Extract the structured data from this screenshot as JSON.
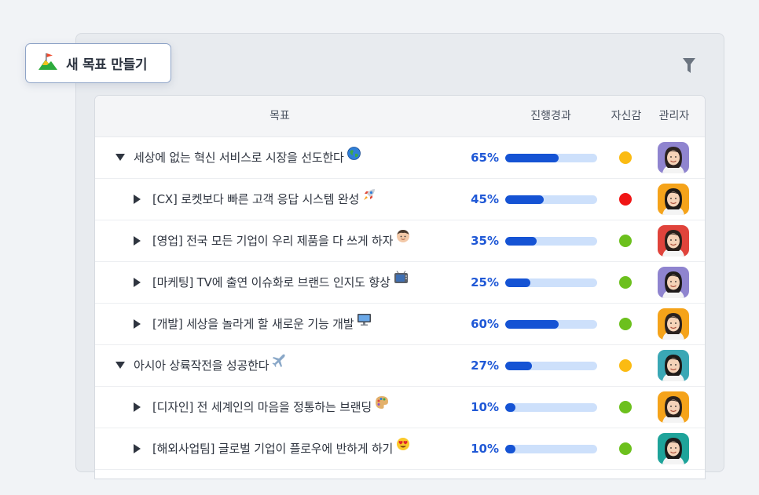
{
  "create_button": {
    "label": "새 목표 만들기",
    "icon": "flag-mountain-icon"
  },
  "filter_button": {
    "icon": "filter-icon"
  },
  "table": {
    "headers": {
      "goal": "목표",
      "progress": "진행경과",
      "confidence": "자신감",
      "manager": "관리자"
    },
    "rows": [
      {
        "level": 0,
        "expanded": true,
        "title": "세상에 없는 혁신 서비스로 시장을 선도한다",
        "emoji": "globe-icon",
        "progress_label": "65%",
        "progress": 0.58,
        "confidence": "yellow",
        "avatar_bg": "#8f84cf"
      },
      {
        "level": 1,
        "expanded": false,
        "title": "[CX] 로켓보다 빠른 고객 응답 시스템 완성",
        "emoji": "rocket-icon",
        "progress_label": "45%",
        "progress": 0.42,
        "confidence": "red",
        "avatar_bg": "#f5a31a"
      },
      {
        "level": 1,
        "expanded": false,
        "title": "[영업] 전국 모든 기업이 우리 제품을 다 쓰게 하자",
        "emoji": "person-icon",
        "progress_label": "35%",
        "progress": 0.34,
        "confidence": "green",
        "avatar_bg": "#e0433b"
      },
      {
        "level": 1,
        "expanded": false,
        "title": "[마케팅] TV에 출연 이슈화로 브랜드 인지도 향상",
        "emoji": "tv-icon",
        "progress_label": "25%",
        "progress": 0.27,
        "confidence": "green",
        "avatar_bg": "#8f84cf"
      },
      {
        "level": 1,
        "expanded": false,
        "title": "[개발] 세상을 놀라게 할 새로운 기능 개발",
        "emoji": "monitor-icon",
        "progress_label": "60%",
        "progress": 0.58,
        "confidence": "green",
        "avatar_bg": "#f5a31a"
      },
      {
        "level": 0,
        "expanded": true,
        "title": "아시아 상륙작전을 성공한다",
        "emoji": "airplane-icon",
        "progress_label": "27%",
        "progress": 0.29,
        "confidence": "yellow",
        "avatar_bg": "#3aa7b5"
      },
      {
        "level": 1,
        "expanded": false,
        "title": "[디자인] 전 세계인의 마음을 정통하는 브랜딩",
        "emoji": "palette-icon",
        "progress_label": "10%",
        "progress": 0.11,
        "confidence": "green",
        "avatar_bg": "#f5a31a"
      },
      {
        "level": 1,
        "expanded": false,
        "title": "[해외사업팀] 글로벌 기업이 플로우에 반하게 하기",
        "emoji": "heart-eyes-icon",
        "progress_label": "10%",
        "progress": 0.11,
        "confidence": "green",
        "avatar_bg": "#1ea39a"
      }
    ]
  },
  "colors": {
    "accent": "#1553d4",
    "bar_track": "#cde0fb",
    "confidence_green": "#6cc01d",
    "confidence_yellow": "#fbbb12",
    "confidence_red": "#f01515"
  }
}
